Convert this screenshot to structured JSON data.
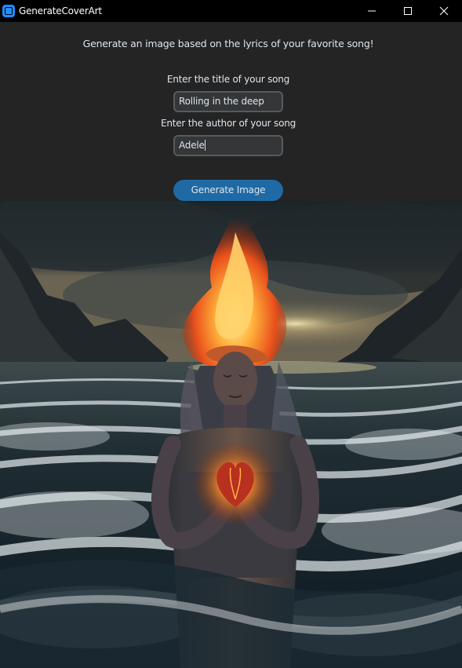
{
  "window": {
    "title": "GenerateCoverArt",
    "icon": "app-icon",
    "controls": [
      "minimize-icon",
      "maximize-icon",
      "close-icon"
    ]
  },
  "form": {
    "heading": "Generate an image based on the lyrics of your favorite song!",
    "title_label": "Enter the title of your song",
    "title_value": "Rolling in the deep",
    "author_label": "Enter the author of your song",
    "author_value": "Adele",
    "generate_button": "Generate Image"
  },
  "colors": {
    "titlebar": "#000000",
    "panel": "#242424",
    "entry_bg": "#343638",
    "entry_border": "#565b5e",
    "accent": "#1f6aa5",
    "text": "#dce4ee"
  }
}
